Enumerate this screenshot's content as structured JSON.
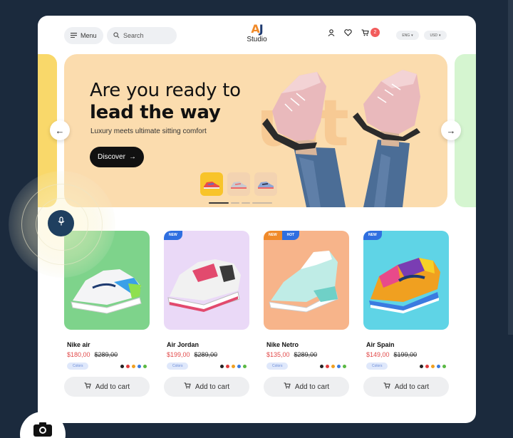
{
  "header": {
    "menu_label": "Menu",
    "search_placeholder": "Search",
    "logo_mark": "AJ",
    "logo_text": "Studio",
    "cart_count": "2",
    "language": "ENG",
    "currency": "USD"
  },
  "hero": {
    "headline_line1": "Are you ready to",
    "headline_line2": "lead the way",
    "subtitle": "Luxury meets ultimate sitting comfort",
    "cta_label": "Discover",
    "background_color": "#fbdcae",
    "slides_total": 4,
    "active_slide": 1
  },
  "products": [
    {
      "name": "Nike air",
      "price": "$180,00",
      "old_price": "$289,00",
      "tags": [],
      "bg": "#7ed38b",
      "colors_label": "Colors",
      "swatches": [
        "#222222",
        "#e23c3c",
        "#f0a020",
        "#3b7be0",
        "#5ab843"
      ]
    },
    {
      "name": "Air Jordan",
      "price": "$199,00",
      "old_price": "$289,00",
      "tags": [
        "NEW"
      ],
      "bg": "#ead9f7",
      "colors_label": "Colors",
      "swatches": [
        "#222222",
        "#e23c3c",
        "#f0a020",
        "#3b7be0",
        "#5ab843"
      ]
    },
    {
      "name": "Nike Netro",
      "price": "$135,00",
      "old_price": "$289,00",
      "tags": [
        "NEW",
        "HOT"
      ],
      "bg": "#f7b48a",
      "colors_label": "Colors",
      "swatches": [
        "#222222",
        "#e23c3c",
        "#f0a020",
        "#3b7be0",
        "#5ab843"
      ]
    },
    {
      "name": "Air Spain",
      "price": "$149,00",
      "old_price": "$199,00",
      "tags": [
        "NEW"
      ],
      "bg": "#5fd4e6",
      "colors_label": "Colors",
      "swatches": [
        "#222222",
        "#e23c3c",
        "#f0a020",
        "#3b7be0",
        "#5ab843"
      ]
    }
  ],
  "add_to_cart_label": "Add to cart",
  "colors": {
    "accent": "#f25c5c",
    "dark": "#111111",
    "background": "#1b2a3d"
  }
}
